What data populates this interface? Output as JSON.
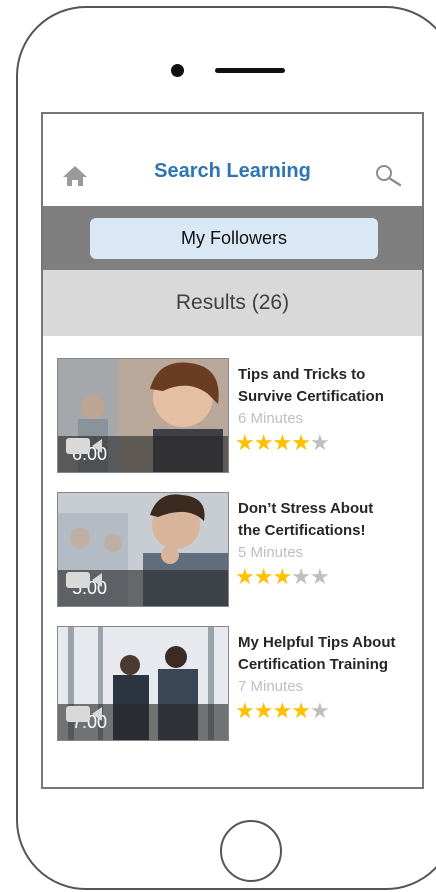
{
  "header": {
    "title": "Search Learning",
    "home_icon": "home-icon",
    "search_icon": "search-icon"
  },
  "filter": {
    "label": "My Followers"
  },
  "results": {
    "heading": "Results (26)",
    "items": [
      {
        "title_line1": "Tips and Tricks to",
        "title_line2": "Survive Certification",
        "length": "6 Minutes",
        "duration": "6:00",
        "rating": 4,
        "max_rating": 5
      },
      {
        "title_line1": "Don’t Stress About",
        "title_line2": "the Certifications!",
        "length": "5 Minutes",
        "duration": "5:00",
        "rating": 3,
        "max_rating": 5
      },
      {
        "title_line1": "My Helpful Tips About",
        "title_line2": "Certification Training",
        "length": "7 Minutes",
        "duration": "7:00",
        "rating": 4,
        "max_rating": 5
      }
    ]
  },
  "colors": {
    "title_blue": "#2e75b6",
    "filter_bar": "#7f7f7f",
    "filter_button": "#dae8f6",
    "results_bar": "#d9d9d9",
    "star_on": "#ffc000",
    "star_off": "#bfbfbf"
  }
}
